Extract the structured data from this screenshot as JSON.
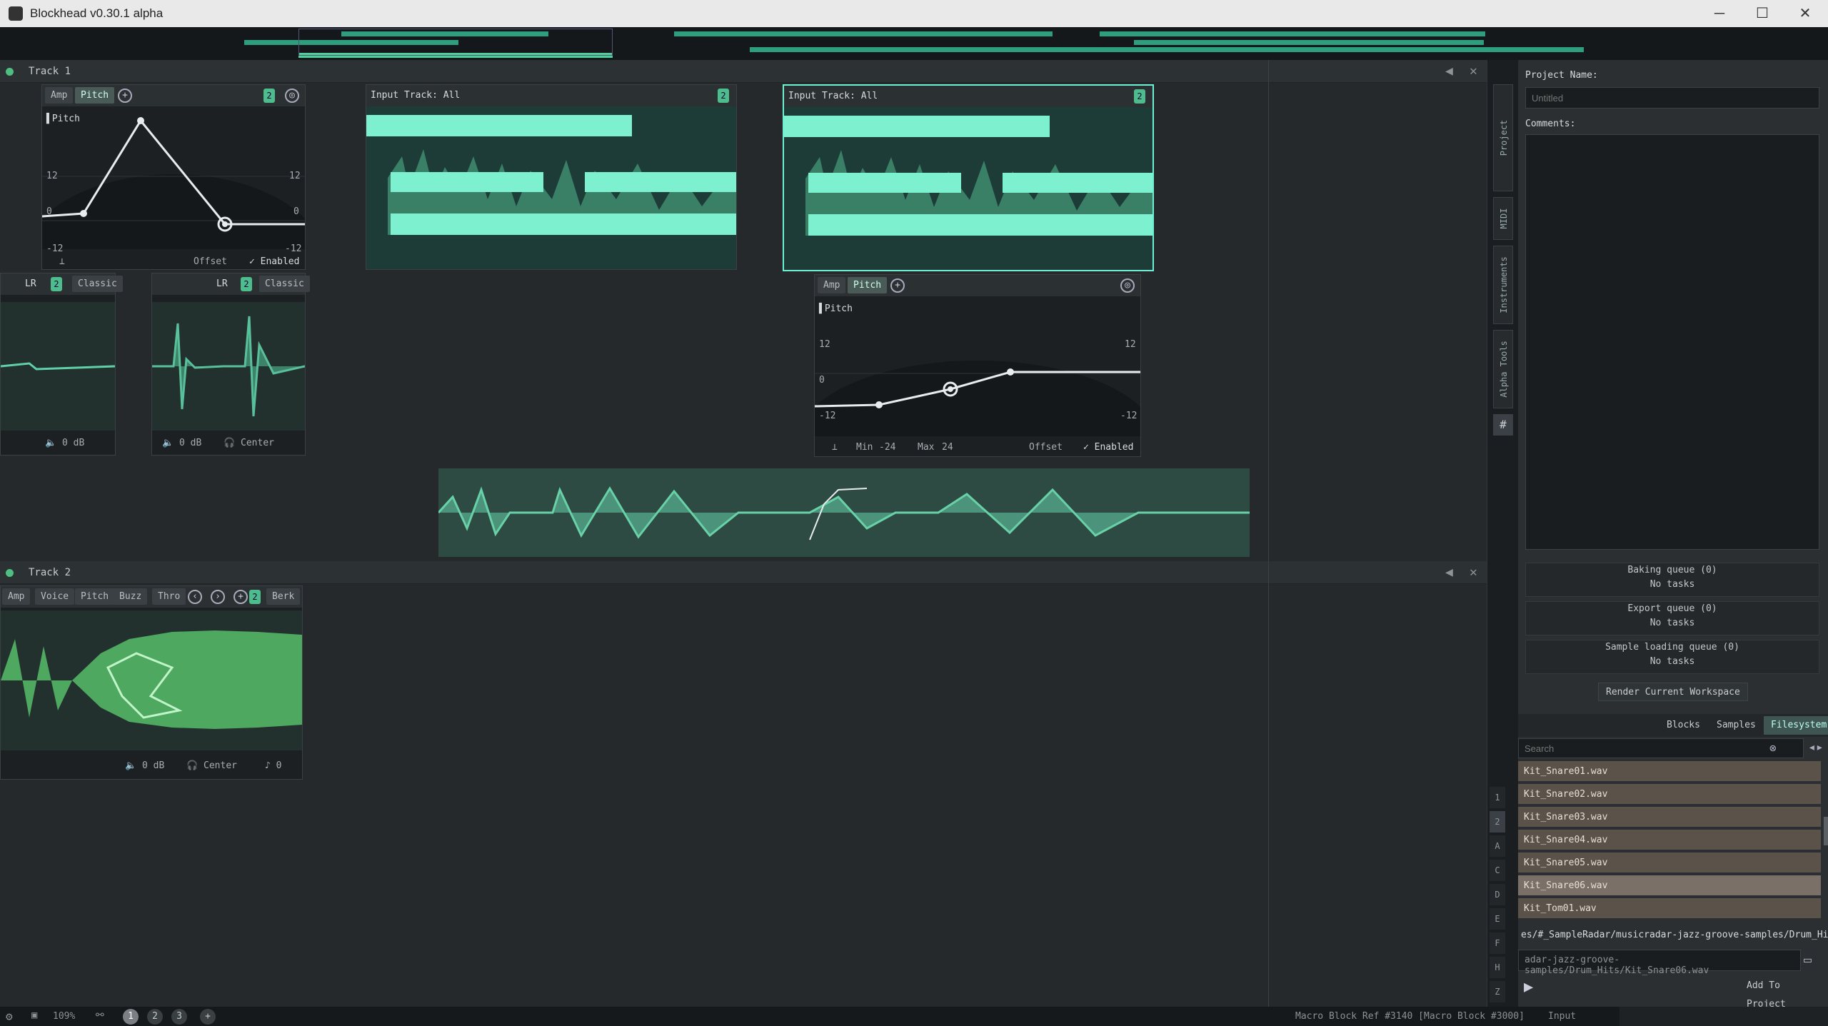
{
  "window": {
    "title": "Blockhead v0.30.1 alpha",
    "controls": [
      "─",
      "☐",
      "✕"
    ]
  },
  "tracks": [
    {
      "name": "Track 1"
    },
    {
      "name": "Track 2"
    }
  ],
  "block_pitch1": {
    "tabs": [
      "Amp",
      "Pitch"
    ],
    "badge": "2",
    "param": "Pitch",
    "scale": [
      "12",
      "0",
      "-12"
    ],
    "offset": "Offset",
    "enabled": "✓ Enabled"
  },
  "block_input1": {
    "title": "Input Track: All",
    "badge": "2"
  },
  "block_input2": {
    "title": "Input Track: All",
    "badge": "2"
  },
  "block_lr1": {
    "mode": "LR",
    "badge": "2",
    "style": "Classic",
    "vol": "0 dB"
  },
  "block_lr2": {
    "mode": "LR",
    "badge": "2",
    "style": "Classic",
    "vol": "0 dB",
    "pan": "Center"
  },
  "block_pitch2": {
    "tabs": [
      "Amp",
      "Pitch"
    ],
    "param": "Pitch",
    "scale": [
      "12",
      "0",
      "-12"
    ],
    "min_label": "Min",
    "min_val": "-24",
    "max_label": "Max",
    "max_val": "24",
    "offset": "Offset",
    "enabled": "✓ Enabled"
  },
  "block_track2": {
    "tabs": [
      "Amp",
      "Voice",
      "Pitch",
      "Buzz",
      "Thro",
      "Berk"
    ],
    "badge": "2",
    "vol": "0 dB",
    "pan": "Center",
    "tune": "0"
  },
  "panel": {
    "vtabs": [
      "Project",
      "MIDI",
      "Instruments",
      "Alpha Tools"
    ],
    "project_name_label": "Project Name:",
    "project_name_placeholder": "Untitled",
    "comments_label": "Comments:",
    "queues": [
      {
        "title": "Baking queue (0)",
        "status": "No tasks"
      },
      {
        "title": "Export queue (0)",
        "status": "No tasks"
      },
      {
        "title": "Sample loading queue (0)",
        "status": "No tasks"
      }
    ],
    "render_button": "Render Current Workspace",
    "browser_tabs": [
      "Blocks",
      "Samples",
      "Filesystem"
    ],
    "search_placeholder": "Search",
    "files": [
      "Kit_Snare01.wav",
      "Kit_Snare02.wav",
      "Kit_Snare03.wav",
      "Kit_Snare04.wav",
      "Kit_Snare05.wav",
      "Kit_Snare06.wav",
      "Kit_Tom01.wav"
    ],
    "selected_file": 5,
    "letters": [
      "1",
      "2",
      "A",
      "C",
      "D",
      "E",
      "F",
      "H",
      "Z"
    ],
    "path": "es/#_SampleRadar/musicradar-jazz-groove-samples/Drum_Hits",
    "file_path": "adar-jazz-groove-samples/Drum_Hits/Kit_Snare06.wav",
    "add_button": "Add To Project"
  },
  "status": {
    "zoom": "109%",
    "pages": [
      "1",
      "2",
      "3"
    ],
    "active_page": 0,
    "ref": "Macro Block Ref #3140 [Macro Block #3000]",
    "input": "Input"
  },
  "colors": {
    "accent": "#4fd0a8",
    "selection": "#6ef0d4",
    "waveform": "#3f8c70",
    "track2_wave": "#4ea860"
  }
}
